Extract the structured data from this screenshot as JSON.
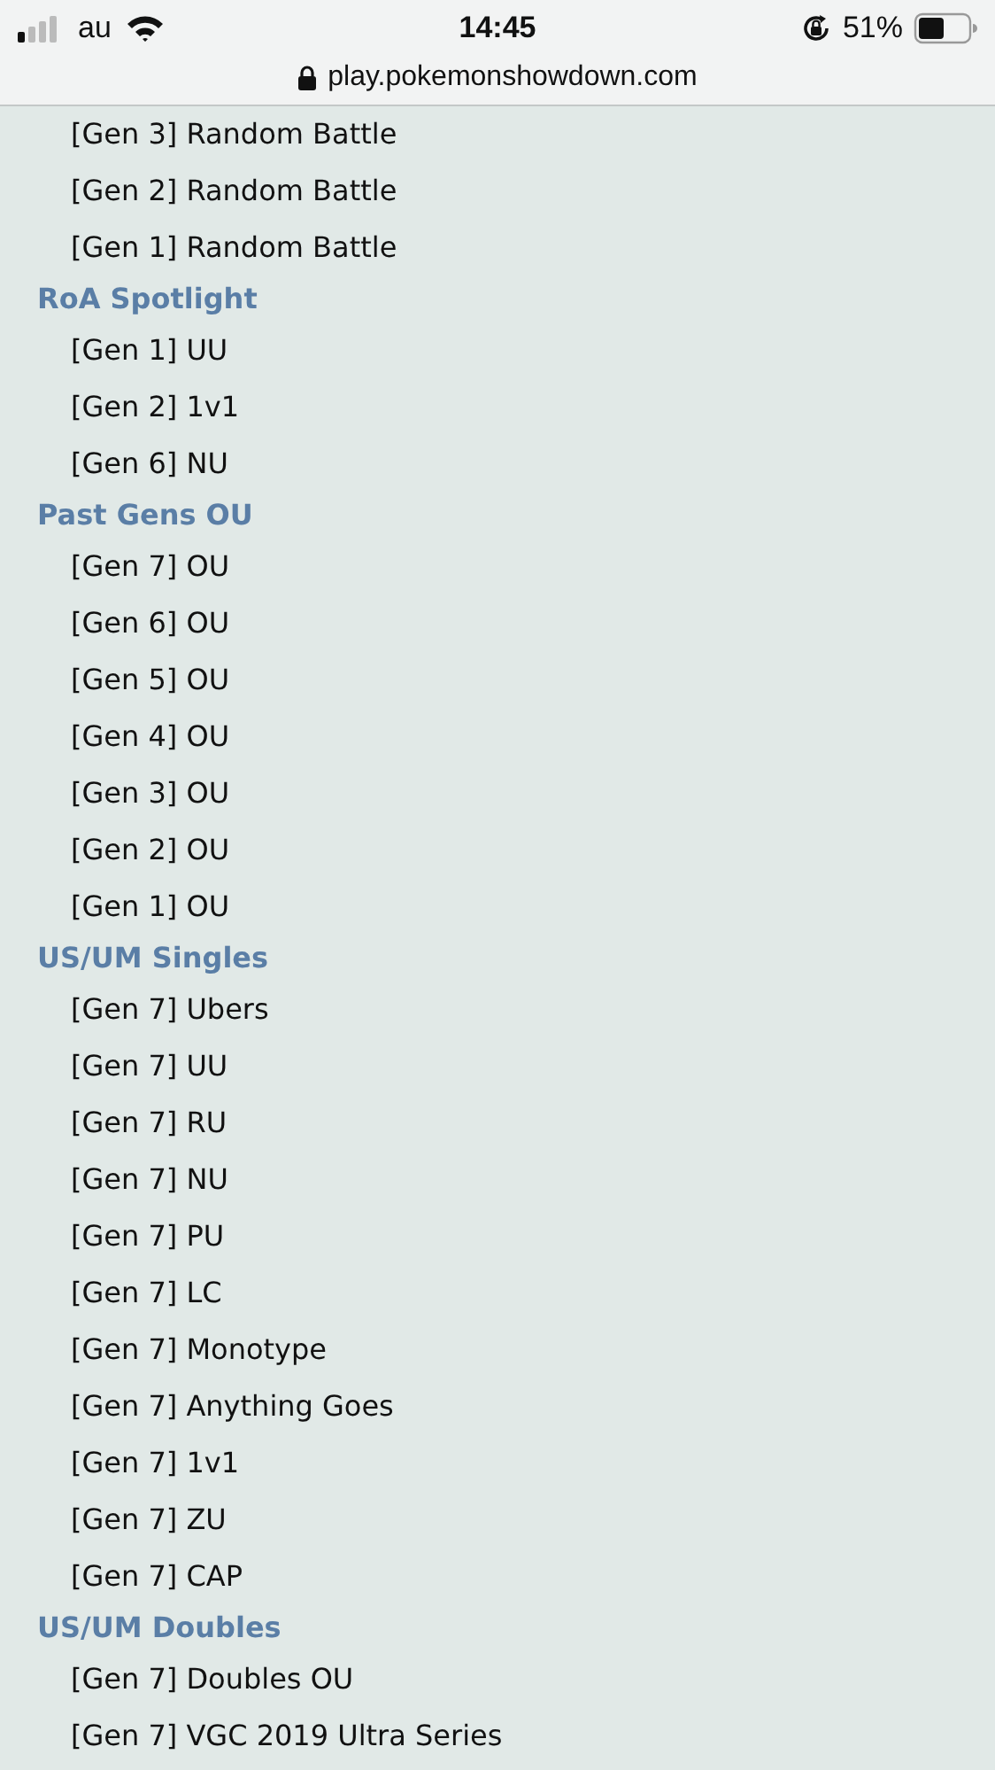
{
  "status_bar": {
    "carrier": "au",
    "time": "14:45",
    "battery": "51%"
  },
  "address_bar": {
    "url": "play.pokemonshowdown.com"
  },
  "list": [
    {
      "kind": "item",
      "label": "[Gen 3] Random Battle"
    },
    {
      "kind": "item",
      "label": "[Gen 2] Random Battle"
    },
    {
      "kind": "item",
      "label": "[Gen 1] Random Battle"
    },
    {
      "kind": "heading",
      "label": "RoA Spotlight"
    },
    {
      "kind": "item",
      "label": "[Gen 1] UU"
    },
    {
      "kind": "item",
      "label": "[Gen 2] 1v1"
    },
    {
      "kind": "item",
      "label": "[Gen 6] NU"
    },
    {
      "kind": "heading",
      "label": "Past Gens OU"
    },
    {
      "kind": "item",
      "label": "[Gen 7] OU"
    },
    {
      "kind": "item",
      "label": "[Gen 6] OU"
    },
    {
      "kind": "item",
      "label": "[Gen 5] OU"
    },
    {
      "kind": "item",
      "label": "[Gen 4] OU"
    },
    {
      "kind": "item",
      "label": "[Gen 3] OU"
    },
    {
      "kind": "item",
      "label": "[Gen 2] OU"
    },
    {
      "kind": "item",
      "label": "[Gen 1] OU"
    },
    {
      "kind": "heading",
      "label": "US/UM Singles"
    },
    {
      "kind": "item",
      "label": "[Gen 7] Ubers"
    },
    {
      "kind": "item",
      "label": "[Gen 7] UU"
    },
    {
      "kind": "item",
      "label": "[Gen 7] RU"
    },
    {
      "kind": "item",
      "label": "[Gen 7] NU"
    },
    {
      "kind": "item",
      "label": "[Gen 7] PU"
    },
    {
      "kind": "item",
      "label": "[Gen 7] LC"
    },
    {
      "kind": "item",
      "label": "[Gen 7] Monotype"
    },
    {
      "kind": "item",
      "label": "[Gen 7] Anything Goes"
    },
    {
      "kind": "item",
      "label": "[Gen 7] 1v1"
    },
    {
      "kind": "item",
      "label": "[Gen 7] ZU"
    },
    {
      "kind": "item",
      "label": "[Gen 7] CAP"
    },
    {
      "kind": "heading",
      "label": "US/UM Doubles"
    },
    {
      "kind": "item",
      "label": "[Gen 7] Doubles OU"
    },
    {
      "kind": "item",
      "label": "[Gen 7] VGC 2019 Ultra Series"
    }
  ]
}
